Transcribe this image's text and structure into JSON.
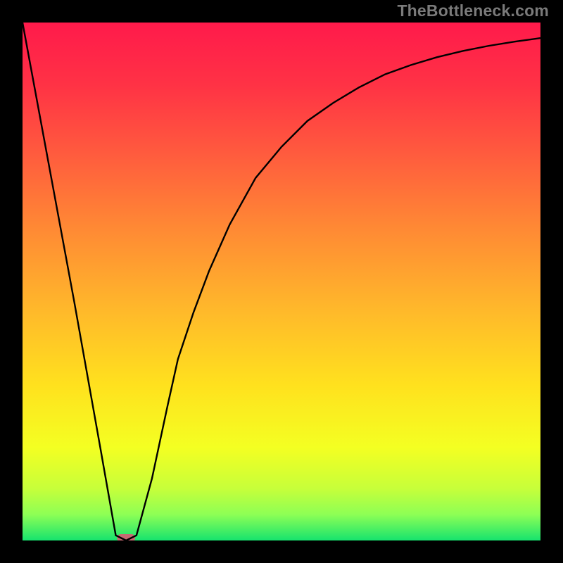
{
  "watermark": "TheBottleneck.com",
  "chart_data": {
    "type": "line",
    "title": "",
    "xlabel": "",
    "ylabel": "",
    "xlim": [
      0,
      100
    ],
    "ylim": [
      0,
      100
    ],
    "series": [
      {
        "name": "curve",
        "x": [
          0,
          5,
          10,
          15,
          18,
          20,
          22,
          25,
          28,
          30,
          33,
          36,
          40,
          45,
          50,
          55,
          60,
          65,
          70,
          75,
          80,
          85,
          90,
          95,
          100
        ],
        "values": [
          100,
          73,
          46,
          18,
          1,
          0,
          1,
          12,
          26,
          35,
          44,
          52,
          61,
          70,
          76,
          81,
          84.5,
          87.5,
          90,
          91.8,
          93.3,
          94.5,
          95.5,
          96.3,
          97
        ]
      }
    ],
    "marker": {
      "x": 20,
      "width": 3.5,
      "color": "#c56a72"
    },
    "gradient_stops": [
      {
        "offset": 0,
        "color": "#ff1a4b"
      },
      {
        "offset": 0.12,
        "color": "#ff3245"
      },
      {
        "offset": 0.25,
        "color": "#ff5a3e"
      },
      {
        "offset": 0.4,
        "color": "#ff8a34"
      },
      {
        "offset": 0.55,
        "color": "#ffb72b"
      },
      {
        "offset": 0.7,
        "color": "#ffe11e"
      },
      {
        "offset": 0.82,
        "color": "#f4ff22"
      },
      {
        "offset": 0.9,
        "color": "#c7ff3a"
      },
      {
        "offset": 0.95,
        "color": "#8dff55"
      },
      {
        "offset": 1.0,
        "color": "#16e36e"
      }
    ],
    "frame": {
      "color": "#000000",
      "thickness": 32
    }
  }
}
